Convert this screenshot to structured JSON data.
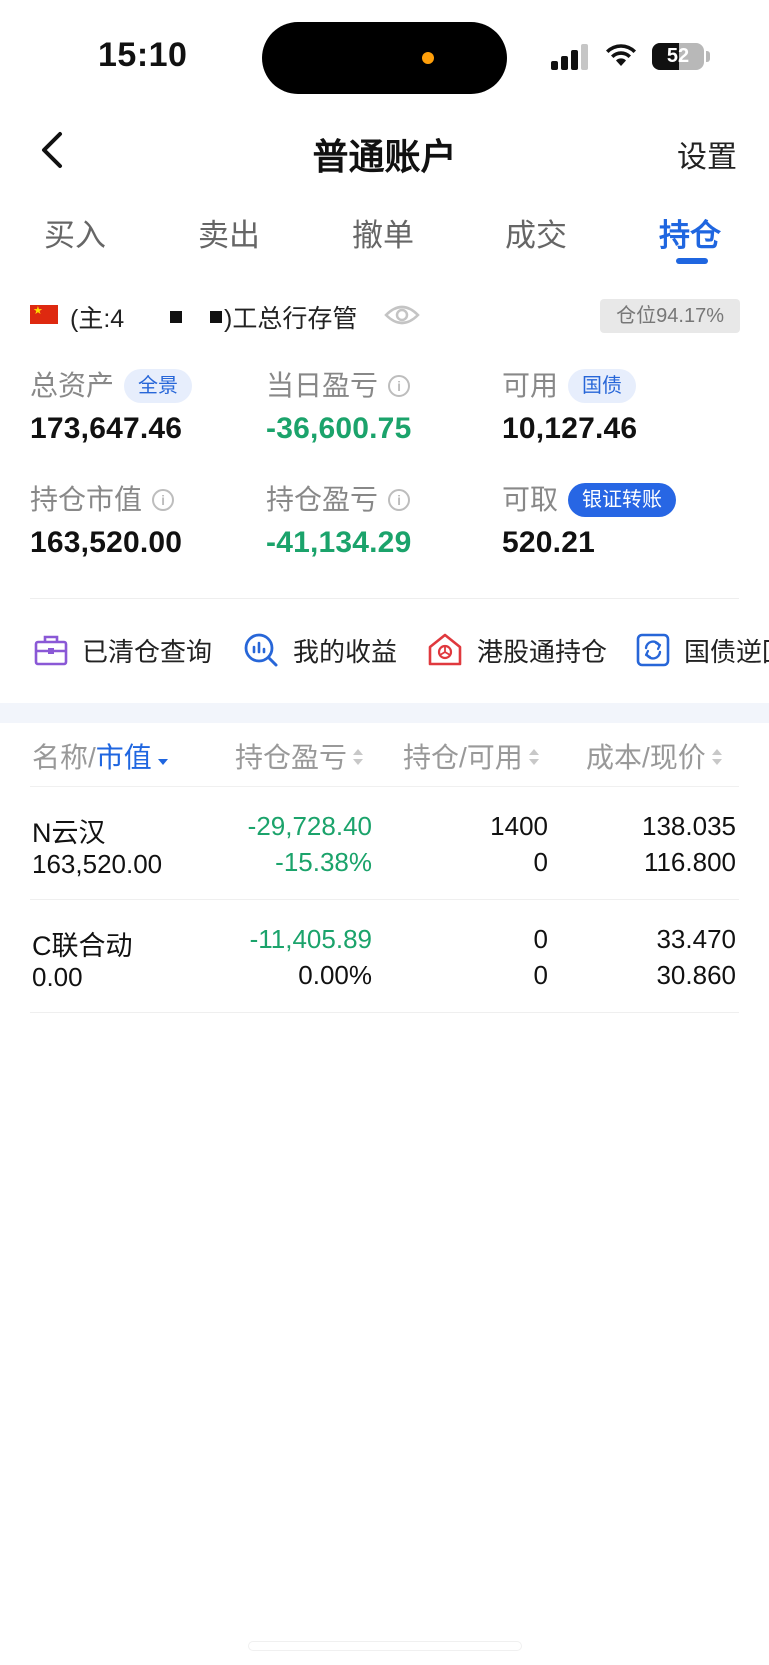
{
  "status_bar": {
    "time": "15:10",
    "battery": "52",
    "battery_level": 0.52
  },
  "nav": {
    "title": "普通账户",
    "right_label": "设置"
  },
  "tabs": [
    {
      "label": "买入",
      "active": false
    },
    {
      "label": "卖出",
      "active": false
    },
    {
      "label": "撤单",
      "active": false
    },
    {
      "label": "成交",
      "active": false
    },
    {
      "label": "持仓",
      "active": true
    }
  ],
  "account": {
    "prefix": "(主:4",
    "suffix": ")工总行存管",
    "position_ratio": "仓位94.17%"
  },
  "stats": {
    "total_assets": {
      "label": "总资产",
      "chip": "全景",
      "value": "173,647.46"
    },
    "daily_pnl": {
      "label": "当日盈亏",
      "value": "-36,600.75"
    },
    "available": {
      "label": "可用",
      "chip": "国债",
      "value": "10,127.46"
    },
    "market_value": {
      "label": "持仓市值",
      "value": "163,520.00"
    },
    "position_pnl": {
      "label": "持仓盈亏",
      "value": "-41,134.29"
    },
    "withdrawable": {
      "label": "可取",
      "chip": "银证转账",
      "value": "520.21"
    }
  },
  "quick_links": [
    {
      "label": "已清仓查询",
      "icon": "briefcase-icon"
    },
    {
      "label": "我的收益",
      "icon": "chart-search-icon"
    },
    {
      "label": "港股通持仓",
      "icon": "hk-house-icon"
    },
    {
      "label": "国债逆回购",
      "icon": "repo-cycle-icon"
    }
  ],
  "table": {
    "headers": {
      "name": "名称/",
      "name_highlight": "市值",
      "pnl": "持仓盈亏",
      "qty": "持仓/可用",
      "cost": "成本/现价"
    },
    "rows": [
      {
        "name": "N云汉",
        "market_value": "163,520.00",
        "pnl": "-29,728.40",
        "pnl_pct": "-15.38%",
        "position": "1400",
        "available": "0",
        "cost": "138.035",
        "price": "116.800"
      },
      {
        "name": "C联合动",
        "market_value": "0.00",
        "pnl": "-11,405.89",
        "pnl_pct": "0.00%",
        "position": "0",
        "available": "0",
        "cost": "33.470",
        "price": "30.860"
      }
    ]
  },
  "colors": {
    "accent": "#1f66e0",
    "loss_green": "#1ba36b",
    "flag_red": "#de2910"
  }
}
